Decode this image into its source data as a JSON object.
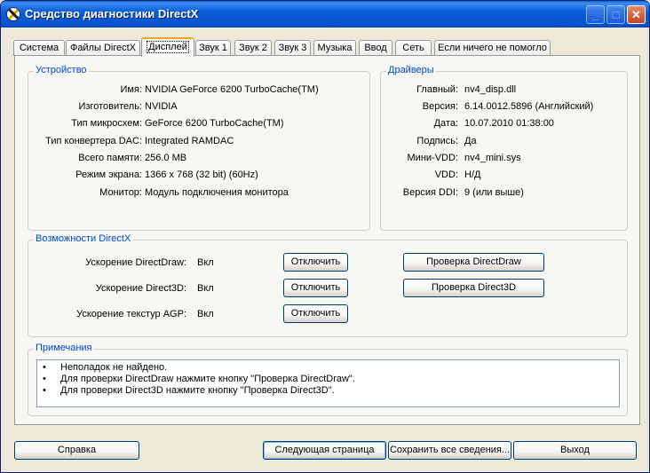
{
  "window": {
    "title": "Средство диагностики DirectX",
    "min": "_",
    "max": "□",
    "close": "✕"
  },
  "tabs": [
    {
      "label": "Система"
    },
    {
      "label": "Файлы DirectX"
    },
    {
      "label": "Дисплей"
    },
    {
      "label": "Звук 1"
    },
    {
      "label": "Звук 2"
    },
    {
      "label": "Звук 3"
    },
    {
      "label": "Музыка"
    },
    {
      "label": "Ввод"
    },
    {
      "label": "Сеть"
    },
    {
      "label": "Если ничего не помогло"
    }
  ],
  "active_tab": "Дисплей",
  "device": {
    "title": "Устройство",
    "rows": [
      {
        "label": "Имя:",
        "value": "NVIDIA GeForce 6200 TurboCache(TM)"
      },
      {
        "label": "Изготовитель:",
        "value": "NVIDIA"
      },
      {
        "label": "Тип микросхем:",
        "value": "GeForce 6200 TurboCache(TM)"
      },
      {
        "label": "Тип конвертера DAC:",
        "value": "Integrated RAMDAC"
      },
      {
        "label": "Всего памяти:",
        "value": "256.0 MB"
      },
      {
        "label": "Режим экрана:",
        "value": "1366 x 768 (32 bit) (60Hz)"
      },
      {
        "label": "Монитор:",
        "value": "Модуль подключения монитора"
      }
    ]
  },
  "drivers": {
    "title": "Драйверы",
    "rows": [
      {
        "label": "Главный:",
        "value": "nv4_disp.dll"
      },
      {
        "label": "Версия:",
        "value": "6.14.0012.5896 (Английский)"
      },
      {
        "label": "Дата:",
        "value": "10.07.2010 01:38:00"
      },
      {
        "label": "Подпись:",
        "value": "Да"
      },
      {
        "label": "Мини-VDD:",
        "value": "nv4_mini.sys"
      },
      {
        "label": "VDD:",
        "value": "Н/Д"
      },
      {
        "label": "Версия DDI:",
        "value": "9 (или выше)"
      }
    ]
  },
  "features": {
    "title": "Возможности DirectX",
    "rows": [
      {
        "label": "Ускорение DirectDraw:",
        "value": "Вкл",
        "button": "Отключить"
      },
      {
        "label": "Ускорение Direct3D:",
        "value": "Вкл",
        "button": "Отключить"
      },
      {
        "label": "Ускорение текстур AGP:",
        "value": "Вкл",
        "button": "Отключить"
      }
    ],
    "test_directdraw": "Проверка DirectDraw",
    "test_direct3d": "Проверка Direct3D"
  },
  "notes": {
    "title": "Примечания",
    "bullet": "•",
    "items": [
      "Неполадок не найдено.",
      "Для проверки DirectDraw нажмите кнопку \"Проверка DirectDraw\".",
      "Для проверки Direct3D нажмите кнопку \"Проверка Direct3D\"."
    ]
  },
  "footer": {
    "help": "Справка",
    "next": "Следующая страница",
    "save": "Сохранить все сведения...",
    "exit": "Выход"
  }
}
